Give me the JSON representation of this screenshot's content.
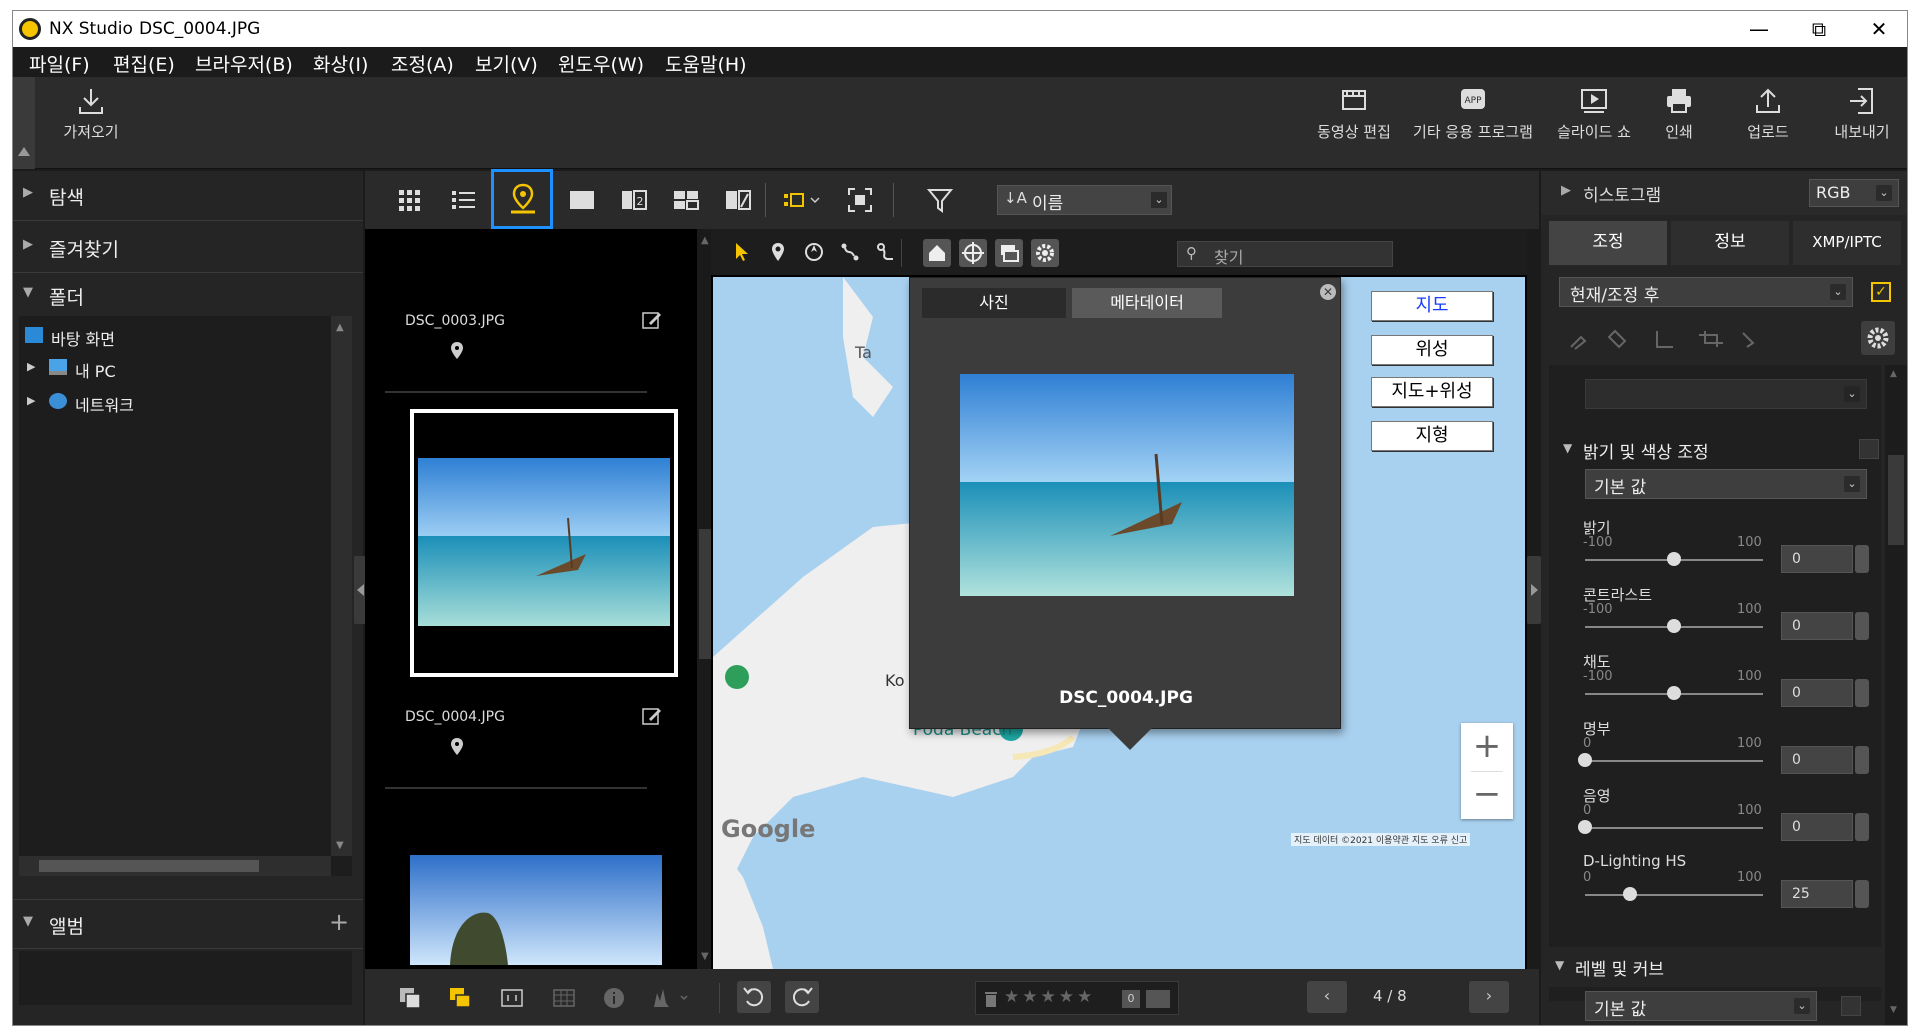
{
  "window": {
    "app_name": "NX Studio",
    "document_name": "DSC_0004.JPG",
    "minimize": "—",
    "restore": "⧉",
    "close": "✕"
  },
  "menu": [
    "파일(F)",
    "편집(E)",
    "브라우저(B)",
    "화상(I)",
    "조정(A)",
    "보기(V)",
    "윈도우(W)",
    "도움말(H)"
  ],
  "toolbar": {
    "import_label": "가져오기",
    "right_items": [
      "동영상 편집",
      "기타 응용 프로그램",
      "슬라이드 쇼",
      "인쇄",
      "업로드",
      "내보내기"
    ]
  },
  "left": {
    "sections": [
      "탐색",
      "즐겨찾기",
      "폴더",
      "앨범"
    ],
    "tree": [
      "바탕 화면",
      "내 PC",
      "네트워크"
    ]
  },
  "view_toolbar": {
    "sort_label": "이름"
  },
  "filmstrip": {
    "items": [
      "DSC_0003.JPG",
      "DSC_0004.JPG"
    ]
  },
  "map": {
    "search_placeholder": "찾기",
    "popup_tabs": [
      "사진",
      "메타데이터"
    ],
    "popup_filename": "DSC_0004.JPG",
    "map_types": [
      "지도",
      "위성",
      "지도+위성",
      "지형"
    ],
    "labels": {
      "ko_poda": "Ko Poda",
      "poda_beach": "Poda Beach",
      "ta": "Ta",
      "google": "Google",
      "attribution": "지도 데이터 ©2021  이용약관  지도 오류 신고"
    },
    "zoom_in": "+",
    "zoom_out": "−"
  },
  "bottom": {
    "page_indicator": "4 / 8"
  },
  "right": {
    "histogram_label": "히스토그램",
    "histogram_mode": "RGB",
    "tabs": [
      "조정",
      "정보",
      "XMP/IPTC"
    ],
    "preset": "현재/조정 후",
    "brightness_section": "밝기 및 색상 조정",
    "brightness_preset": "기본 값",
    "sliders": [
      {
        "label": "밝기",
        "min": "-100",
        "max": "100",
        "value": "0",
        "level": 0.5
      },
      {
        "label": "콘트라스트",
        "min": "-100",
        "max": "100",
        "value": "0",
        "level": 0.5
      },
      {
        "label": "채도",
        "min": "-100",
        "max": "100",
        "value": "0",
        "level": 0.5
      },
      {
        "label": "명부",
        "min": "0",
        "max": "100",
        "value": "0",
        "level": 0
      },
      {
        "label": "음영",
        "min": "0",
        "max": "100",
        "value": "0",
        "level": 0
      },
      {
        "label": "D-Lighting HS",
        "min": "0",
        "max": "100",
        "value": "25",
        "level": 0.25
      }
    ],
    "levels_section": "레벨 및 커브",
    "levels_preset": "기본 값"
  },
  "colors": {
    "accent_highlight": "#1e90ff",
    "map_active_icon": "#f5c400",
    "map_water": "#a8d0ef",
    "map_land": "#efefef"
  }
}
